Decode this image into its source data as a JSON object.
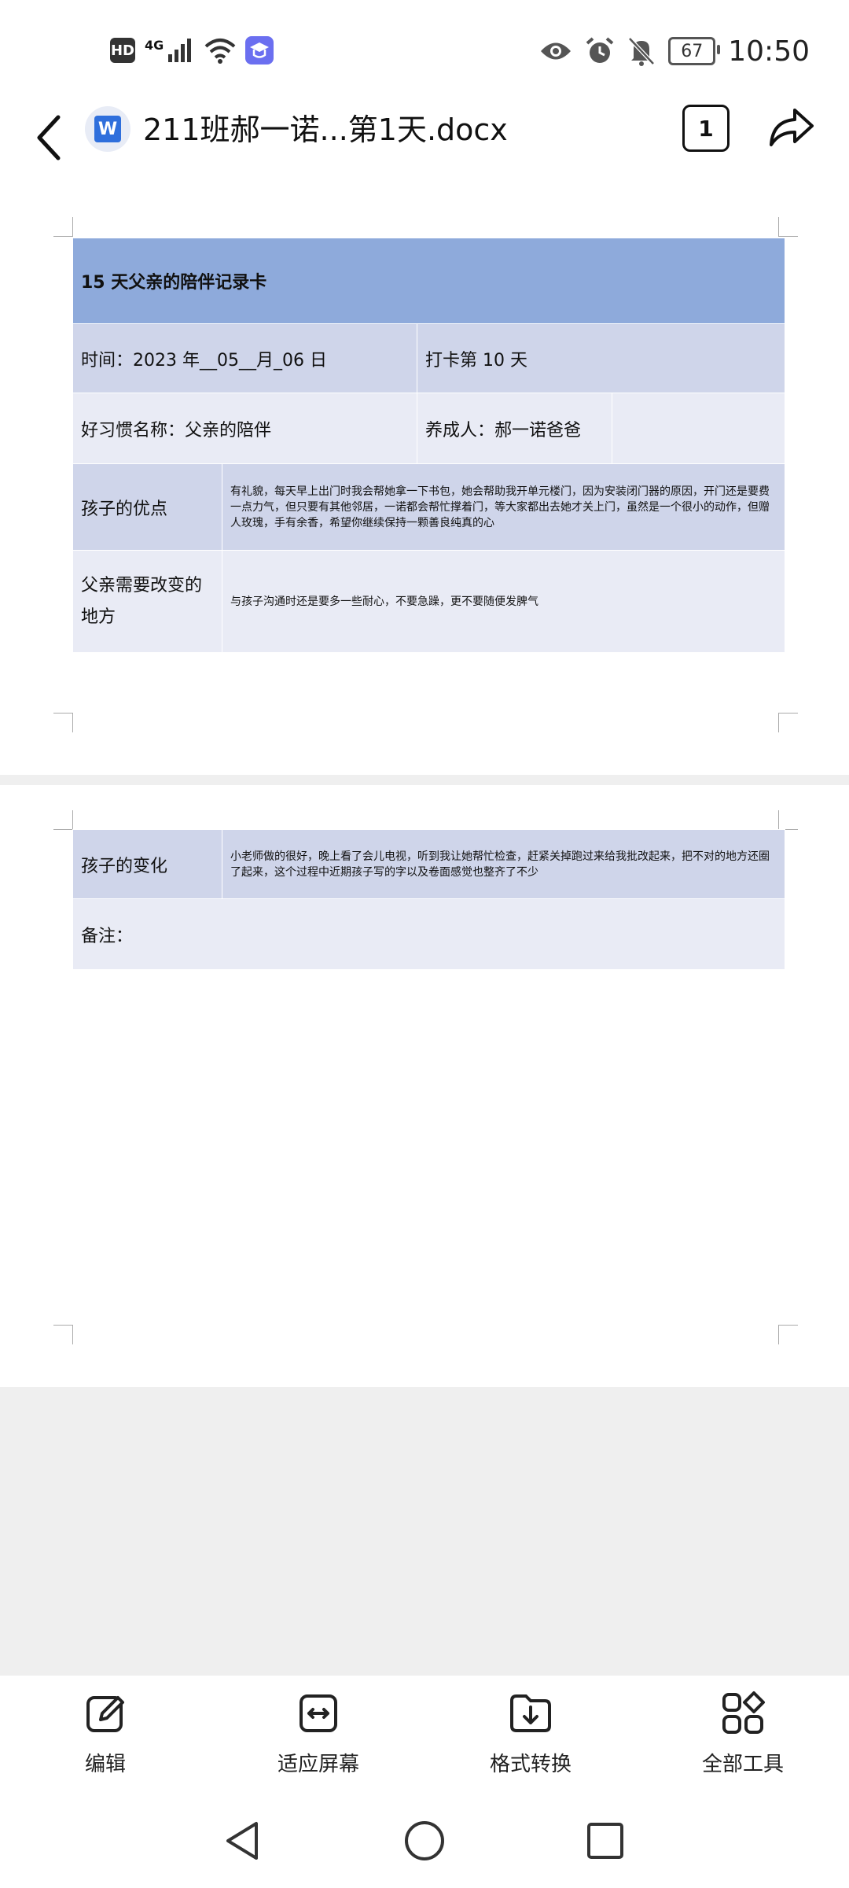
{
  "status_bar": {
    "hd": "HD",
    "network": "4G",
    "time": "10:50",
    "battery": "67"
  },
  "app_bar": {
    "file_icon_letter": "W",
    "title": "211班郝一诺...第1天.docx",
    "page_count": "1"
  },
  "document": {
    "card_title": "15 天父亲的陪伴记录卡",
    "date": "时间：2023 年__05__月_06 日",
    "checkin": "打卡第 10 天",
    "habit": "好习惯名称：父亲的陪伴",
    "cultivator": "养成人：郝一诺爸爸",
    "strengths_label": "孩子的优点",
    "strengths_text": "有礼貌，每天早上出门时我会帮她拿一下书包，她会帮助我开单元楼门，因为安装闭门器的原因，开门还是要费一点力气，但只要有其他邻居，一诺都会帮忙撑着门，等大家都出去她才关上门，虽然是一个很小的动作，但赠人玫瑰，手有余香，希望你继续保持一颗善良纯真的心",
    "father_change_label": "父亲需要改变的地方",
    "father_change_text": "与孩子沟通时还是要多一些耐心，不要急躁，更不要随便发脾气",
    "child_change_label": "孩子的变化",
    "child_change_text": "小老师做的很好，晚上看了会儿电视，听到我让她帮忙检查，赶紧关掉跑过来给我批改起来，把不对的地方还圈了起来，这个过程中近期孩子写的字以及卷面感觉也整齐了不少",
    "remarks": "备注："
  },
  "toolbar": {
    "edit": "编辑",
    "fit_screen": "适应屏幕",
    "convert": "格式转换",
    "all_tools": "全部工具"
  }
}
